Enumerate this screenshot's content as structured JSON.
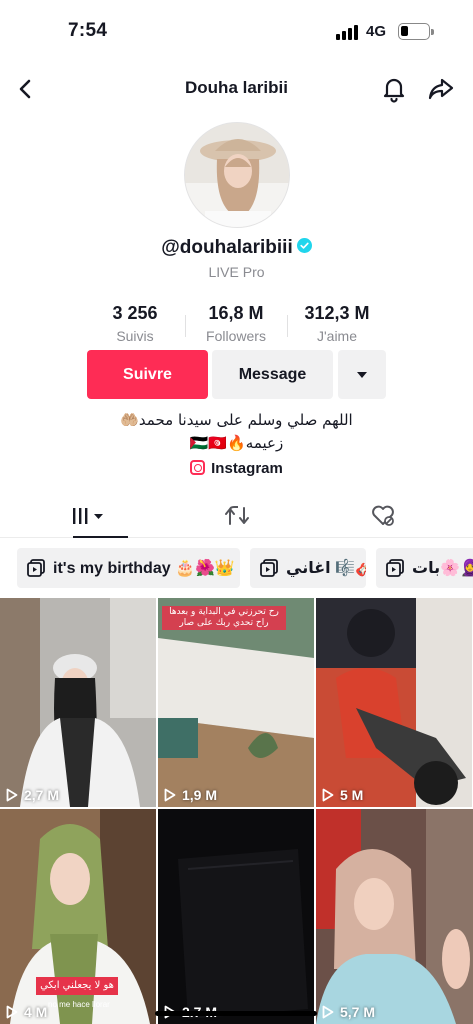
{
  "status_bar": {
    "time": "7:54",
    "network": "4G"
  },
  "header": {
    "title": "Douha laribii"
  },
  "profile": {
    "username": "@douhalaribiii",
    "badge": "LIVE Pro",
    "stats": [
      {
        "value": "3 256",
        "label": "Suivis"
      },
      {
        "value": "16,8 M",
        "label": "Followers"
      },
      {
        "value": "312,3 M",
        "label": "J'aime"
      }
    ],
    "follow_label": "Suivre",
    "message_label": "Message",
    "bio_line1": "اللهم صلي وسلم على سيدنا محمد🤲🏼",
    "bio_line2": "زعيمه🔥🇵🇸🇹🇳",
    "link_label": "Instagram"
  },
  "playlists": [
    {
      "label": "it's my birthday 🎂🌺👑"
    },
    {
      "label": "اغاني 🎼🎸"
    },
    {
      "label": "بات🌸🧕"
    }
  ],
  "videos": [
    {
      "views": "2,7 M"
    },
    {
      "views": "1,9 M",
      "caption": "رح تحرزني في البداية و بعدها راح تحدي ربك على صار"
    },
    {
      "views": "5 M"
    },
    {
      "views": "4 M",
      "caption": "هو لا يجعلني ابكي",
      "sub": "no me hace llorar"
    },
    {
      "views": "2.7 M"
    },
    {
      "views": "5,7 M"
    }
  ],
  "colors": {
    "accent": "#fe2c55",
    "verified": "#20d5ec"
  }
}
